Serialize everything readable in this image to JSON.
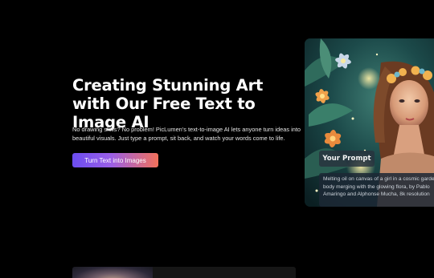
{
  "hero": {
    "title": "Creating Stunning Art with Our Free Text to Image AI",
    "description": "No drawing skills? No problem! PicLumen's text-to-image AI lets anyone turn ideas into beautiful visuals. Just type a prompt, sit back, and watch your words come to life.",
    "cta_label": "Turn Text into Images"
  },
  "showcase": {
    "prompt_badge": "Your Prompt",
    "prompt_text": "Melting oil on canvas of a girl in a cosmic garden, body merging with the glowing flora, by Pablo Amaringo and Alphonse Mucha, 8k resolution"
  },
  "colors": {
    "background": "#000000",
    "cta_gradient_start": "#6b4df0",
    "cta_gradient_end": "#f2715a"
  }
}
